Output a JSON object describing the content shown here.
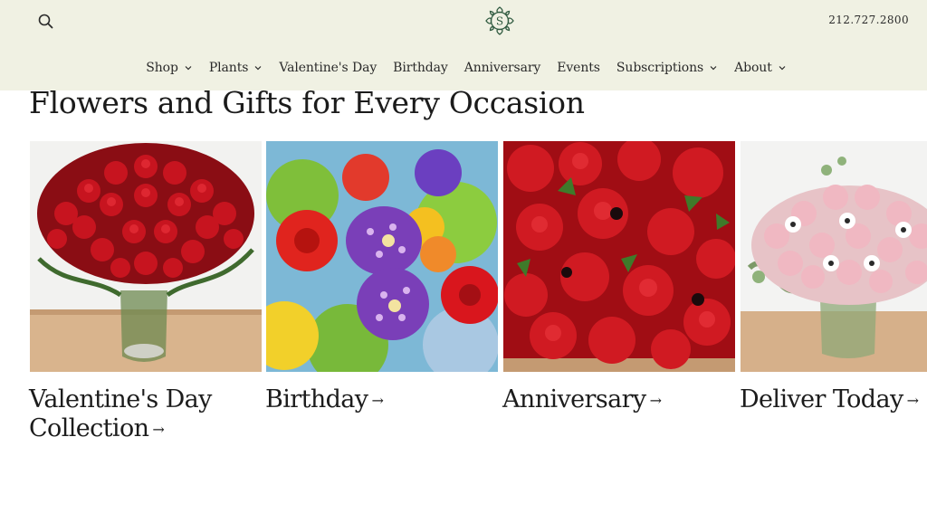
{
  "header": {
    "phone": "212.727.2800",
    "logo_letter": "S"
  },
  "nav": [
    {
      "label": "Shop",
      "dropdown": true
    },
    {
      "label": "Plants",
      "dropdown": true
    },
    {
      "label": "Valentine's Day",
      "dropdown": false
    },
    {
      "label": "Birthday",
      "dropdown": false
    },
    {
      "label": "Anniversary",
      "dropdown": false
    },
    {
      "label": "Events",
      "dropdown": false
    },
    {
      "label": "Subscriptions",
      "dropdown": true
    },
    {
      "label": "About",
      "dropdown": true
    }
  ],
  "section": {
    "heading": "Flowers and Gifts for Every Occasion"
  },
  "tiles": [
    {
      "line1": "Valentine's Day",
      "line2": "Collection",
      "arrow": "→",
      "image_icon": "red-roses-vase-image"
    },
    {
      "line1": "Birthday",
      "arrow": "→",
      "image_icon": "mixed-bouquet-image"
    },
    {
      "line1": "Anniversary",
      "arrow": "→",
      "image_icon": "red-anemone-roses-image"
    },
    {
      "line1": "Deliver Today",
      "arrow": "→",
      "image_icon": "pink-roses-vase-image"
    }
  ],
  "colors": {
    "header_bg": "#f0f1e3",
    "logo_green": "#2f5a3f",
    "text": "#1f1f1f"
  }
}
